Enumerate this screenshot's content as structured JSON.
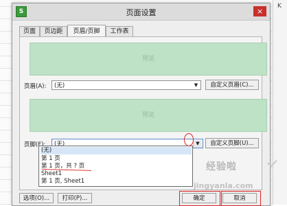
{
  "background": {
    "column_letter": "K"
  },
  "dialog": {
    "app_icon": "S",
    "title": "页面设置",
    "close_label": "×",
    "tabs": [
      {
        "label": "页面"
      },
      {
        "label": "页边距"
      },
      {
        "label": "页眉/页脚",
        "active": true
      },
      {
        "label": "工作表"
      }
    ],
    "header": {
      "preview_label": "预览",
      "label": "页眉(A):",
      "value": "(无)",
      "custom_button": "自定义页眉(C)..."
    },
    "footer": {
      "preview_label": "预览",
      "label": "页脚(F):",
      "value": "(无)",
      "custom_button": "自定义页脚(U)...",
      "dropdown_options": [
        "(无)",
        "第 1 页",
        "第 1 页，共 ? 页",
        "Sheet1",
        "第 1 页, Sheet1"
      ],
      "selected_index": 0
    },
    "buttons": {
      "options": "选项(O)...",
      "print": "打印(P)...",
      "ok": "确定",
      "cancel": "取消"
    }
  },
  "watermark": {
    "text": "经验啦",
    "url_text": "jingyanla.com"
  },
  "colors": {
    "preview_bg": "#bde2c6",
    "annotation": "#d22222",
    "close_button": "#c9302c"
  }
}
